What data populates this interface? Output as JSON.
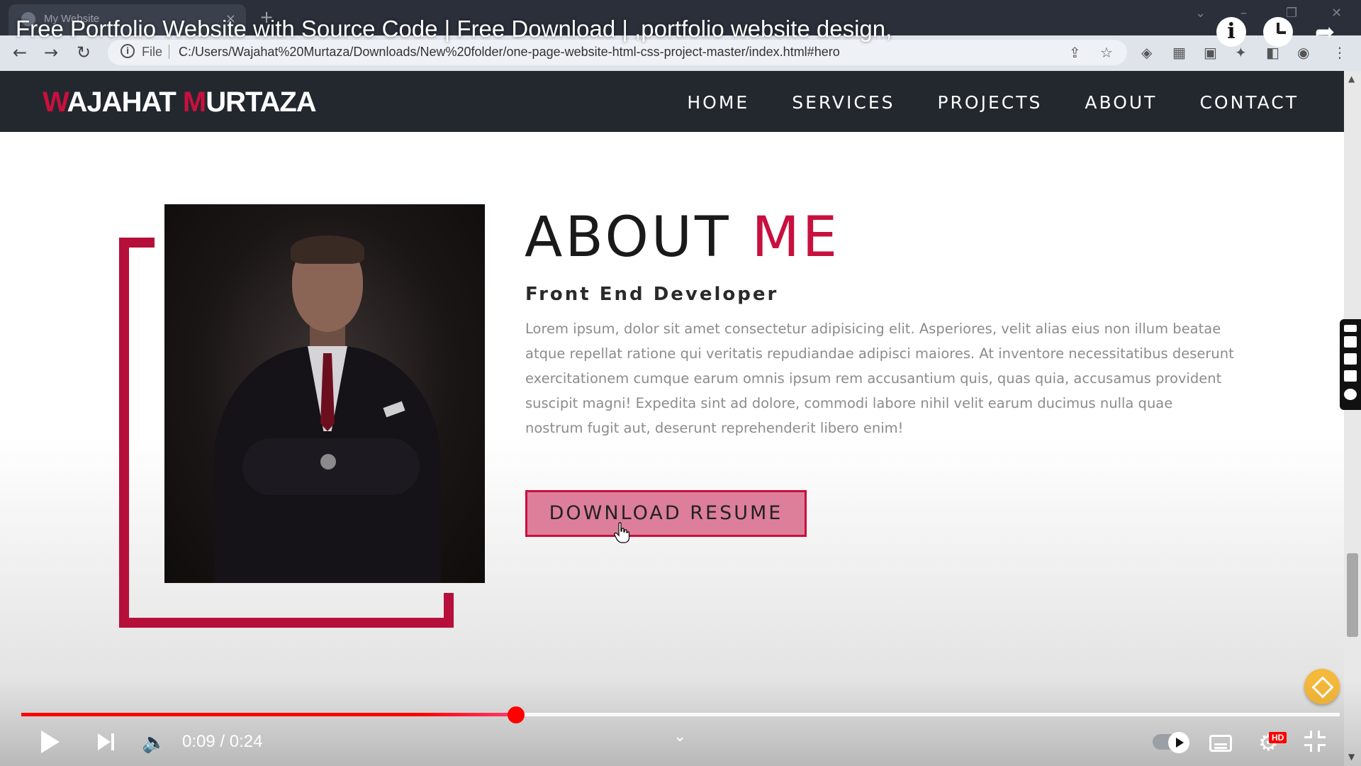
{
  "browser": {
    "tab_title": "My Website",
    "tab_close": "×",
    "new_tab": "+",
    "address_scheme": "File",
    "address_url": "C:/Users/Wajahat%20Murtaza/Downloads/New%20folder/one-page-website-html-css-project-master/index.html#hero",
    "back_icon": "arrow-left-icon",
    "forward_icon": "arrow-right-icon",
    "reload_icon": "reload-icon"
  },
  "video": {
    "title": "Free Portfolio Website with Source Code | Free Download | ,portfolio website design,",
    "current_time": "0:09 / 0:24",
    "progress_fraction": 0.375,
    "buffered_fraction": 1.0,
    "hd_badge": "HD",
    "accent_color": "#ff0000"
  },
  "site": {
    "logo": {
      "first_initial": "W",
      "first_rest": "AJAHAT ",
      "last_initial": "M",
      "last_rest": "URTAZA"
    },
    "nav": [
      "HOME",
      "SERVICES",
      "PROJECTS",
      "ABOUT",
      "CONTACT"
    ],
    "about": {
      "title_main": "ABOUT ",
      "title_accent": "ME",
      "subtitle": "Front End Developer",
      "body": "Lorem ipsum, dolor sit amet consectetur adipisicing elit. Asperiores, velit alias eius non illum beatae atque repellat ratione qui veritatis repudiandae adipisci maiores. At inventore necessitatibus deserunt exercitationem cumque earum omnis ipsum rem accusantium quis, quas quia, accusamus provident suscipit magni! Expedita sint ad dolore, commodi labore nihil velit earum ducimus nulla quae nostrum fugit aut, deserunt reprehenderit libero enim!",
      "button": "DOWNLOAD RESUME"
    },
    "accent_color": "#c8103e",
    "nav_background": "#23272e"
  }
}
